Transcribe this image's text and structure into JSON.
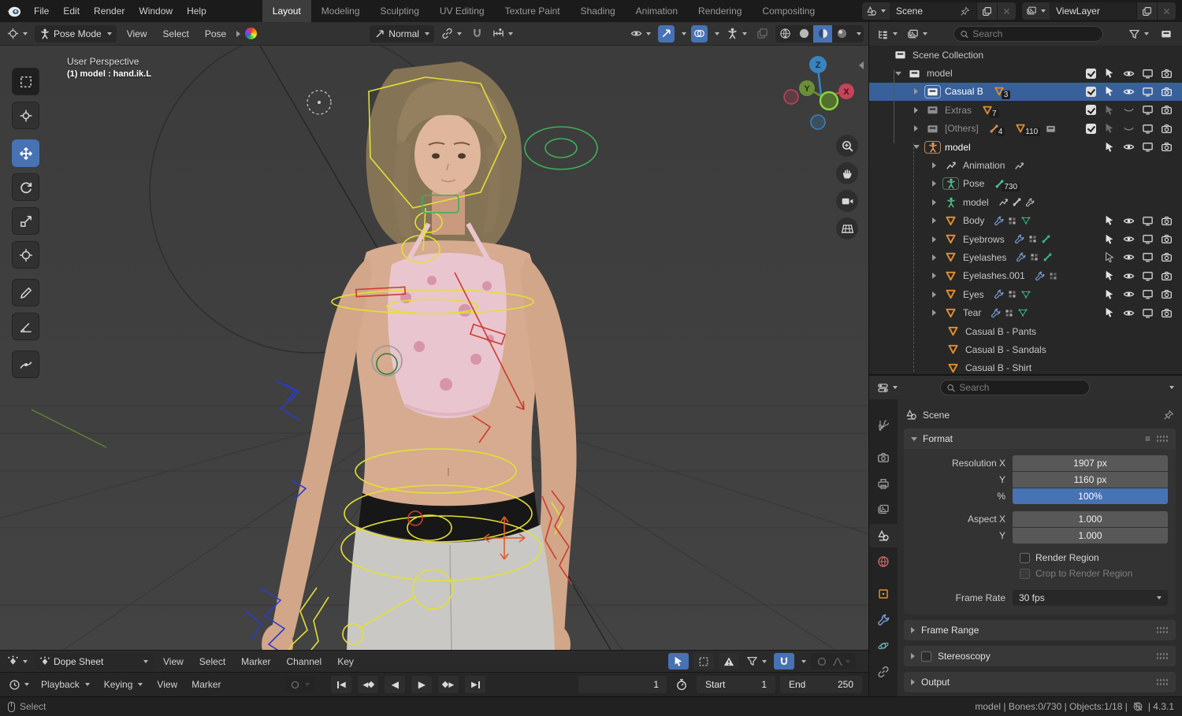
{
  "topbar": {
    "menus": [
      "File",
      "Edit",
      "Render",
      "Window",
      "Help"
    ],
    "workspaces": [
      "Layout",
      "Modeling",
      "Sculpting",
      "UV Editing",
      "Texture Paint",
      "Shading",
      "Animation",
      "Rendering",
      "Compositing"
    ],
    "active_workspace": "Layout",
    "scene_name": "Scene",
    "viewlayer_name": "ViewLayer"
  },
  "viewport": {
    "mode": "Pose Mode",
    "menus": [
      "View",
      "Select",
      "Pose"
    ],
    "orientation": "Normal",
    "overlay_line1": "User Perspective",
    "overlay_line2": "(1) model : hand.ik.L",
    "gizmo": {
      "z": "Z",
      "y": "Y",
      "x": "X"
    }
  },
  "outliner": {
    "search_placeholder": "Search",
    "rows": [
      {
        "label": "Scene Collection"
      },
      {
        "label": "model"
      },
      {
        "label": "Casual B",
        "mesh_count": "3"
      },
      {
        "label": "Extras",
        "mesh_count": "7"
      },
      {
        "label": "[Others]",
        "armature_count": "4",
        "mesh_count": "110"
      },
      {
        "label": "model"
      },
      {
        "label": "Animation"
      },
      {
        "label": "Pose",
        "bone_count": "730"
      },
      {
        "label": "model"
      },
      {
        "label": "Body"
      },
      {
        "label": "Eyebrows"
      },
      {
        "label": "Eyelashes"
      },
      {
        "label": "Eyelashes.001"
      },
      {
        "label": "Eyes"
      },
      {
        "label": "Tear"
      },
      {
        "label": "Casual B - Pants"
      },
      {
        "label": "Casual B - Sandals"
      },
      {
        "label": "Casual B - Shirt"
      }
    ]
  },
  "properties": {
    "search_placeholder": "Search",
    "breadcrumb": "Scene",
    "format": {
      "title": "Format",
      "resolution_x_label": "Resolution X",
      "resolution_x": "1907 px",
      "resolution_y_label": "Y",
      "resolution_y": "1160 px",
      "percent_label": "%",
      "percent": "100%",
      "aspect_x_label": "Aspect X",
      "aspect_x": "1.000",
      "aspect_y_label": "Y",
      "aspect_y": "1.000",
      "render_region_label": "Render Region",
      "crop_label": "Crop to Render Region",
      "frame_rate_label": "Frame Rate",
      "frame_rate": "30 fps"
    },
    "collapsed_panels": [
      "Frame Range",
      "Stereoscopy",
      "Output"
    ]
  },
  "dopesheet": {
    "editor": "Dope Sheet",
    "menus": [
      "View",
      "Select",
      "Marker",
      "Channel",
      "Key"
    ]
  },
  "timeline": {
    "playback": "Playback",
    "keying": "Keying",
    "menus": [
      "View",
      "Marker"
    ],
    "current_frame": "1",
    "start_label": "Start",
    "start_value": "1",
    "end_label": "End",
    "end_value": "250"
  },
  "statusbar": {
    "left": "Select",
    "right_before_icon": "model | Bones:0/730 | Objects:1/18 |",
    "right_after_icon": "| 4.3.1"
  },
  "colors": {
    "accent_blue": "#4772b3",
    "selection_row": "#38619b",
    "mesh_orange": "#e0902f",
    "data_green": "#36b27a"
  }
}
